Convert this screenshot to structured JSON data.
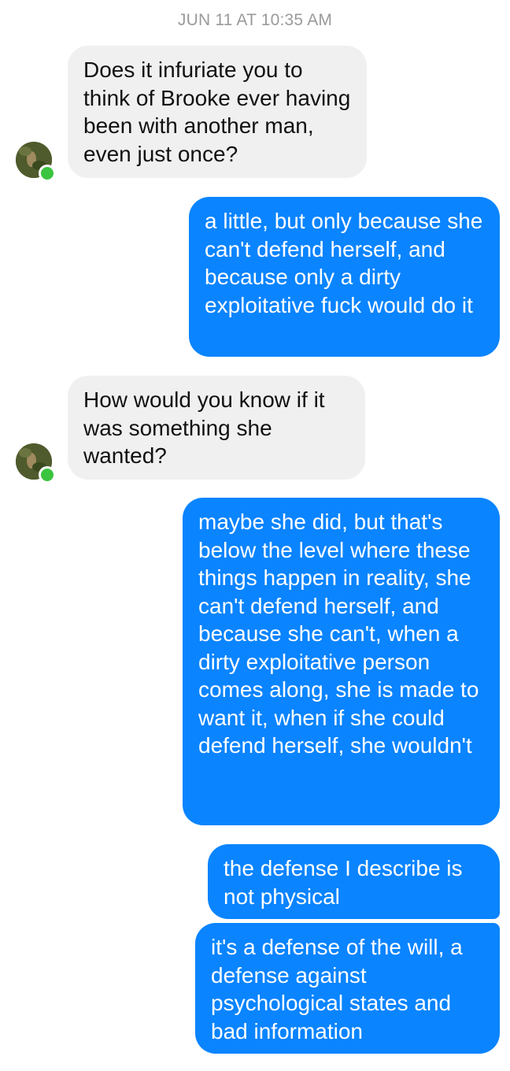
{
  "timestamp": "JUN 11 AT 10:35 AM",
  "messages": [
    {
      "sender": "them",
      "text": "Does it infuriate you to think of Brooke ever having been with another man, even just once?"
    },
    {
      "sender": "me",
      "text": "a little, but only because she can't defend herself, and because only a dirty exploitative fuck would do it"
    },
    {
      "sender": "them",
      "text": "How would you know if it was something she wanted?"
    },
    {
      "sender": "me",
      "text": "maybe she did, but that's below the level where these things happen in reality, she can't defend herself, and because she can't, when a dirty exploitative person comes along, she is made to want it, when if she could defend herself, she wouldn't"
    },
    {
      "sender": "me",
      "text": "the defense I describe is not physical"
    },
    {
      "sender": "me",
      "text": "it's a defense of the will, a defense against psychological states and bad information"
    }
  ],
  "colors": {
    "incoming_bubble": "#f1f0f0",
    "outgoing_bubble": "#0a84ff",
    "online_indicator": "#3bc43f"
  },
  "icons": [
    "avatar-photo",
    "online-status-dot"
  ]
}
